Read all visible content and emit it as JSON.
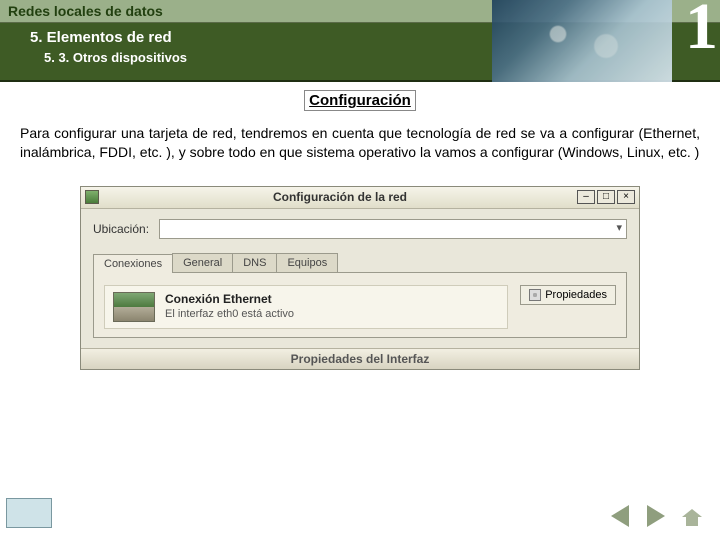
{
  "header": {
    "title": "Redes locales de datos",
    "section": "5.  Elementos de red",
    "subsection": "5. 3. Otros dispositivos",
    "page_number": "1"
  },
  "content": {
    "heading": "Configuración",
    "paragraph": "Para configurar una tarjeta de red, tendremos en cuenta que tecnología de red se va a configurar (Ethernet, inalámbrica, FDDI, etc. ), y sobre todo en que sistema operativo la vamos a configurar (Windows, Linux, etc. )"
  },
  "dialog": {
    "title": "Configuración de la red",
    "win_buttons": {
      "min": "–",
      "max": "□",
      "close": "×"
    },
    "location_label": "Ubicación:",
    "tabs": [
      "Conexiones",
      "General",
      "DNS",
      "Equipos"
    ],
    "active_tab": 0,
    "connection": {
      "title": "Conexión Ethernet",
      "subtitle": "El interfaz eth0 está activo"
    },
    "properties_btn": "Propiedades",
    "sub_dialog_title": "Propiedades del Interfaz"
  },
  "nav": {
    "prev": "prev",
    "next": "next",
    "home": "home"
  }
}
